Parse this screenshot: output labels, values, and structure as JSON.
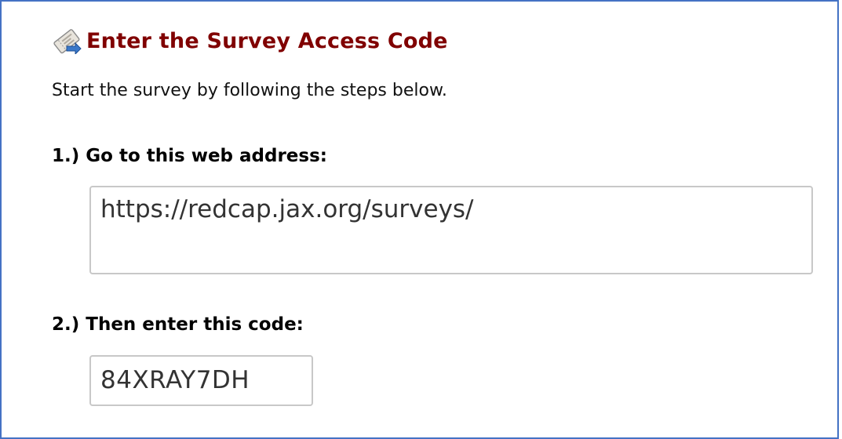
{
  "header": {
    "icon": "ticket-arrow-icon",
    "title": "Enter the Survey Access Code"
  },
  "intro": {
    "text": "Start the survey by following the steps below."
  },
  "steps": [
    {
      "label": "1.) Go to this web address:",
      "value": "https://redcap.jax.org/surveys/"
    },
    {
      "label": "2.) Then enter this code:",
      "value": "84XRAY7DH"
    }
  ],
  "colors": {
    "title": "#800000",
    "panel_border": "#4472c4",
    "field_border": "#c8c8c8",
    "field_text": "#333333"
  }
}
